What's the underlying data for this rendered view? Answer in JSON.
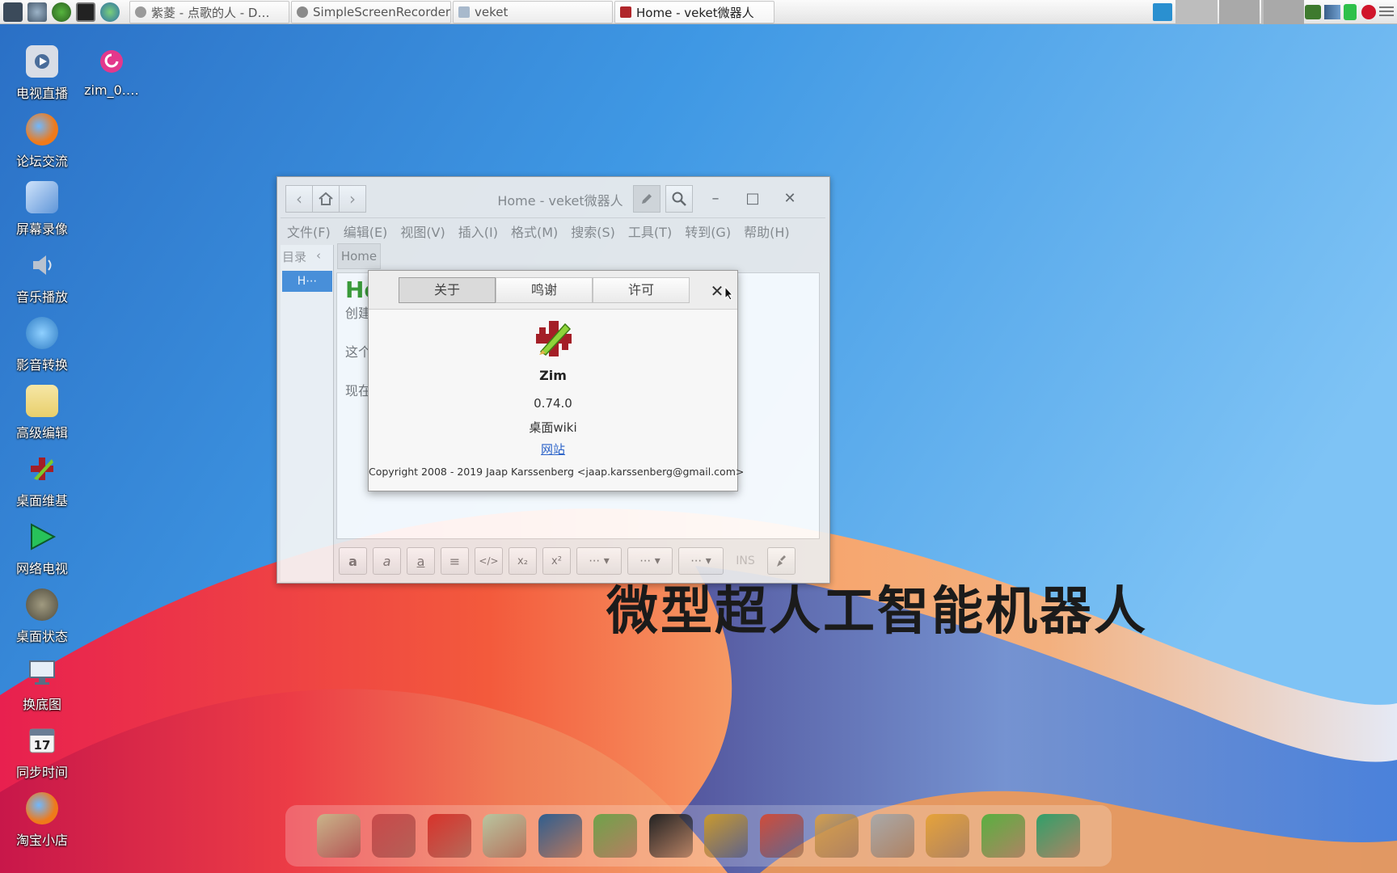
{
  "taskbar": {
    "tasks": [
      {
        "label": "紫菱 - 点歌的人 - D…",
        "icon": "music-app-icon"
      },
      {
        "label": "SimpleScreenRecorder",
        "icon": "recorder-app-icon"
      },
      {
        "label": "veket",
        "icon": "folder-icon"
      },
      {
        "label": "Home - veket微器人",
        "icon": "zim-app-icon"
      }
    ]
  },
  "desktop": {
    "icons": [
      {
        "label": "电视直播",
        "color": "#d8dde6"
      },
      {
        "label": "zim_0.…",
        "color": "#e3388c"
      },
      {
        "label": "论坛交流",
        "color": "#ef7a1a"
      },
      {
        "label": "屏幕录像",
        "color": "#7fb0e6"
      },
      {
        "label": "音乐播放",
        "color": "#b9c2cf"
      },
      {
        "label": "影音转换",
        "color": "#4aa3e0"
      },
      {
        "label": "高级编辑",
        "color": "#f1d27a"
      },
      {
        "label": "桌面维基",
        "color": "#b0262b"
      },
      {
        "label": "网络电视",
        "color": "#27c25a"
      },
      {
        "label": "桌面状态",
        "color": "#6d6a5c"
      },
      {
        "label": "换底图",
        "color": "#4f78a6"
      },
      {
        "label": "同步时间",
        "color": "#e6e6e6"
      },
      {
        "label": "淘宝小店",
        "color": "#ef7a1a"
      }
    ]
  },
  "window": {
    "title": "Home - veket微器人",
    "menu": [
      "文件(F)",
      "编辑(E)",
      "视图(V)",
      "插入(I)",
      "格式(M)",
      "搜索(S)",
      "工具(T)",
      "转到(G)",
      "帮助(H)"
    ],
    "sidebar_header": "目录",
    "sidebar_item": "H⋯",
    "page_tab": "Home",
    "editor": {
      "heading": "Ho",
      "lines": [
        "创建",
        "这个",
        "现在"
      ]
    },
    "format_buttons": [
      "a",
      "a",
      "a",
      "≡",
      "</>",
      "x₂",
      "x²",
      "⋯ ▾",
      "⋯ ▾",
      "⋯ ▾"
    ],
    "ins_label": "INS"
  },
  "about": {
    "tabs": [
      "关于",
      "鸣谢",
      "许可"
    ],
    "app_name": "Zim",
    "version": "0.74.0",
    "description": "桌面wiki",
    "website_label": "网站",
    "copyright": "Copyright 2008 - 2019 Jaap Karssenberg <jaap.karssenberg@gmail.com>"
  },
  "overlay_caption": "微型超人工智能机器人",
  "dock": {
    "items": [
      {
        "icon": "file-manager-icon",
        "color": "#c9b58a"
      },
      {
        "icon": "monitor-icon",
        "color": "#c94a4a"
      },
      {
        "icon": "fox-icon",
        "color": "#d8332b"
      },
      {
        "icon": "notepad-icon",
        "color": "#b8c6a0"
      },
      {
        "icon": "media-player-icon",
        "color": "#2f5e8f"
      },
      {
        "icon": "chat-users-icon",
        "color": "#6ea34a"
      },
      {
        "icon": "penguin-icon",
        "color": "#222222"
      },
      {
        "icon": "address-book-icon",
        "color": "#c99a2e"
      },
      {
        "icon": "chart-icon",
        "color": "#d04c3a"
      },
      {
        "icon": "paint-palette-icon",
        "color": "#d8a04a"
      },
      {
        "icon": "usb-drive-icon",
        "color": "#a9a9a9"
      },
      {
        "icon": "veket-mascot-icon",
        "color": "#e6a33a"
      },
      {
        "icon": "help-icon",
        "color": "#58b040"
      },
      {
        "icon": "camera-icon",
        "color": "#2fa06a"
      }
    ]
  }
}
